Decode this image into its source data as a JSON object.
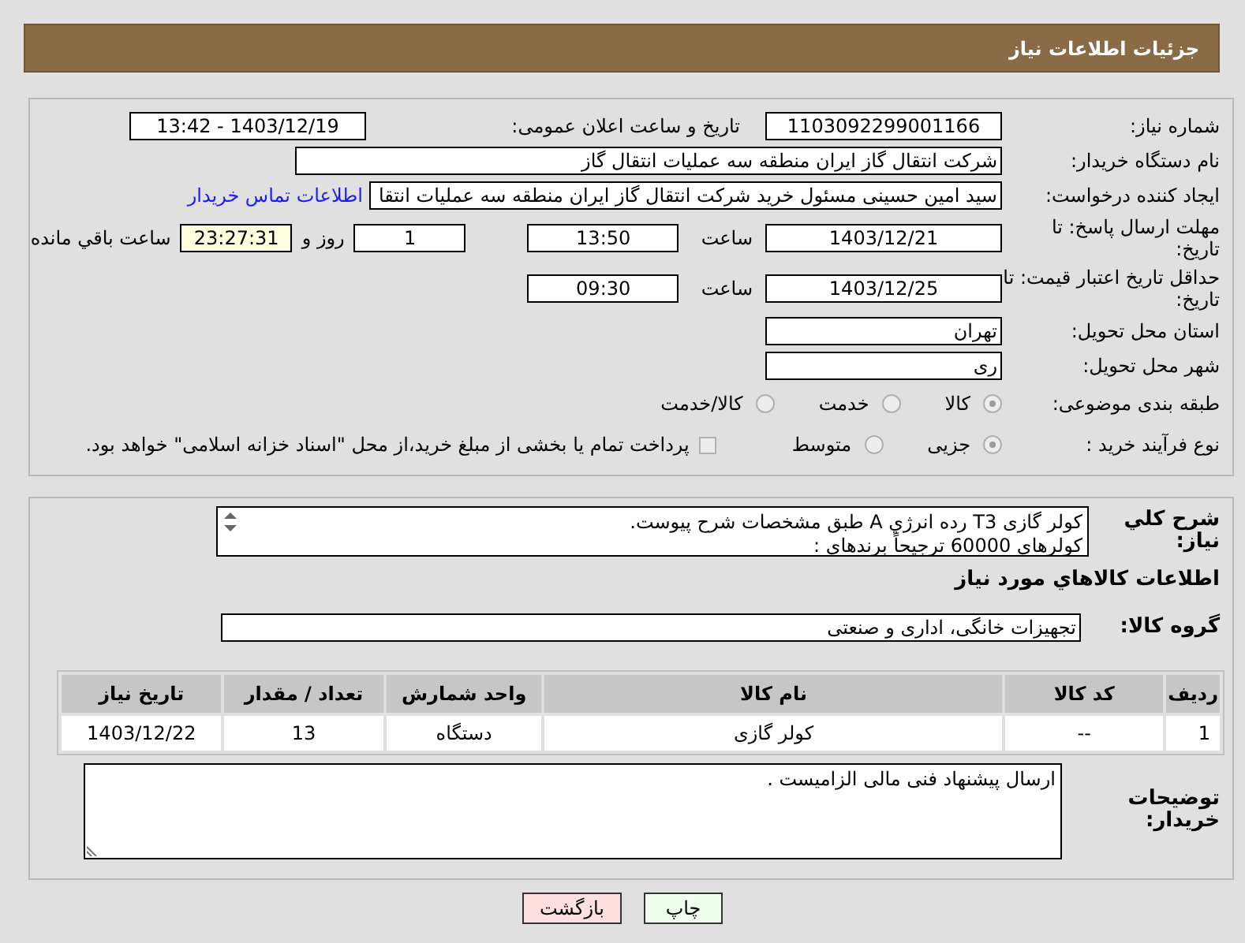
{
  "header": {
    "title": "جزئیات اطلاعات نیاز"
  },
  "need_number": {
    "label": "شماره نیاز:",
    "value": "1103092299001166"
  },
  "announce": {
    "label": "تاریخ و ساعت اعلان عمومی:",
    "value": "1403/12/19 - 13:42"
  },
  "buyer_org": {
    "label": "نام دستگاه خریدار:",
    "value": "شرکت انتقال گاز ایران منطقه سه عملیات انتقال گاز"
  },
  "requester": {
    "label": "ایجاد کننده درخواست:",
    "value": "سید امین حسینی مسئول خرید شرکت انتقال گاز ایران منطقه سه عملیات انتقا",
    "link": "اطلاعات تماس خریدار"
  },
  "reply_deadline": {
    "label": "مهلت ارسال پاسخ: تا تاریخ:",
    "date": "1403/12/21",
    "time_label": "ساعت",
    "time": "13:50",
    "days": "1",
    "days_label": "روز و",
    "remaining": "23:27:31",
    "remaining_label": "ساعت باقي مانده"
  },
  "price_validity": {
    "label": "حداقل تاریخ اعتبار قیمت: تا تاریخ:",
    "date": "1403/12/25",
    "time_label": "ساعت",
    "time": "09:30"
  },
  "province": {
    "label": "استان محل تحویل:",
    "value": "تهران"
  },
  "city": {
    "label": "شهر محل تحویل:",
    "value": "ری"
  },
  "category": {
    "label": "طبقه بندی موضوعی:",
    "options": [
      {
        "label": "کالا",
        "selected": true
      },
      {
        "label": "خدمت",
        "selected": false
      },
      {
        "label": "کالا/خدمت",
        "selected": false
      }
    ]
  },
  "process": {
    "label": "نوع فرآیند خرید :",
    "options": [
      {
        "label": "جزیی",
        "selected": true
      },
      {
        "label": "متوسط",
        "selected": false
      }
    ],
    "payment": {
      "label": "پرداخت تمام یا بخشی از مبلغ خرید،از محل \"اسناد خزانه اسلامی\" خواهد بود.",
      "checked": false
    }
  },
  "description": {
    "label": "شرح کلي نیاز:",
    "lines": [
      "کولر گازی T3  رده انرژي A طبق مشخصات شرح پیوست.",
      "کولرهای 60000 ترجیحاً برندهای :"
    ]
  },
  "goods_title": "اطلاعات کالاهاي مورد نیاز",
  "goods_group": {
    "label": "گروه کالا:",
    "value": "تجهیزات خانگی، اداری و صنعتی"
  },
  "table": {
    "columns": [
      "ردیف",
      "کد کالا",
      "نام کالا",
      "واحد شمارش",
      "تعداد / مقدار",
      "تاریخ نیاز"
    ],
    "rows": [
      [
        "1",
        "--",
        "کولر گازی",
        "دستگاه",
        "13",
        "1403/12/22"
      ]
    ]
  },
  "buyer_notes": {
    "label": "توضیحات خریدار:",
    "value": "ارسال پیشنهاد فنی مالی الزامیست ."
  },
  "buttons": [
    {
      "label": "چاپ",
      "kind": "print"
    },
    {
      "label": "بازگشت",
      "kind": "back"
    }
  ]
}
